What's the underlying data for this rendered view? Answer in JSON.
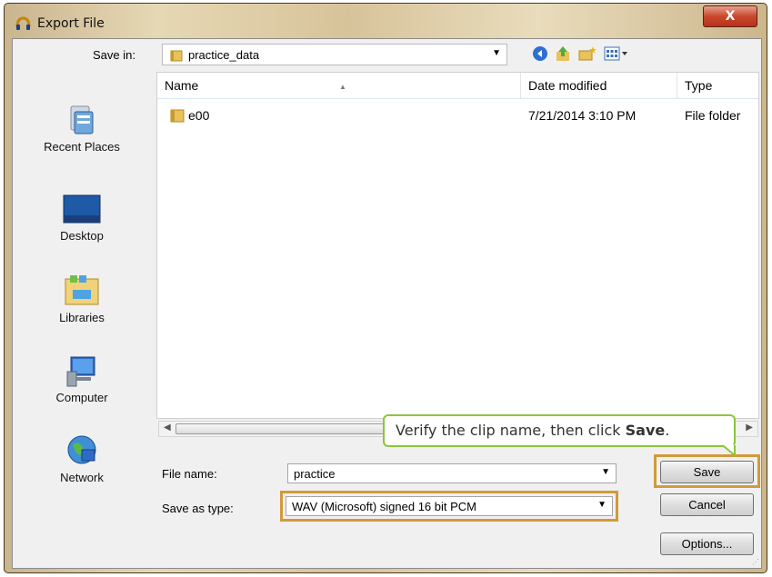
{
  "window": {
    "title": "Export File",
    "close_label": "X"
  },
  "save_in": {
    "label": "Save in:",
    "value": "practice_data"
  },
  "places": [
    "Recent Places",
    "Desktop",
    "Libraries",
    "Computer",
    "Network"
  ],
  "columns": {
    "name": "Name",
    "date_modified": "Date modified",
    "type": "Type"
  },
  "files": [
    {
      "name": "e00",
      "date_modified": "7/21/2014 3:10 PM",
      "type": "File folder"
    }
  ],
  "file_name": {
    "label": "File name:",
    "value": "practice"
  },
  "save_as_type": {
    "label": "Save as type:",
    "value": "WAV (Microsoft) signed 16 bit PCM"
  },
  "buttons": {
    "save": "Save",
    "cancel": "Cancel",
    "options": "Options..."
  },
  "tooltip": {
    "text": "Verify the clip name, then click ",
    "bold": "Save",
    "end": "."
  },
  "colors": {
    "highlight": "#d39a3a",
    "tooltip_border": "#8cc43c"
  }
}
